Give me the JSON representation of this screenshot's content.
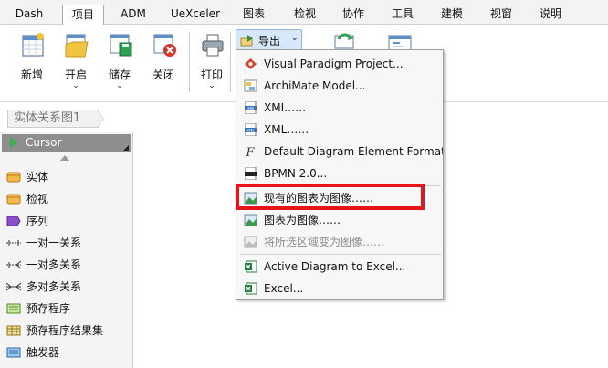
{
  "menubar": {
    "tabs": [
      "Dash",
      "项目",
      "ADM",
      "UeXceler",
      "图表",
      "检视",
      "协作",
      "工具",
      "建模",
      "视窗",
      "说明"
    ],
    "active_tab": "项目"
  },
  "ribbon": {
    "new_label": "新增",
    "open_label": "开启",
    "save_label": "储存",
    "close_label": "关闭",
    "print_label": "打印",
    "export_label": "导出"
  },
  "breadcrumb": {
    "item": "实体关系图1"
  },
  "palette": {
    "cursor_label": "Cursor",
    "items": [
      "实体",
      "检视",
      "序列",
      "一对一关系",
      "一对多关系",
      "多对多关系",
      "预存程序",
      "预存程序结果集",
      "触发器"
    ]
  },
  "export_menu": {
    "items": [
      "Visual Paradigm Project...",
      "ArchiMate Model...",
      "XMI……",
      "XML……",
      "Default Diagram Element Format...",
      "BPMN 2.0...",
      "现有的图表为图像……",
      "图表为图像……",
      "将所选区域变为图像……",
      "Active Diagram to Excel...",
      "Excel..."
    ],
    "disabled_item": "将所选区域变为图像……",
    "highlighted_item": "现有的图表为图像……"
  },
  "colors": {
    "highlight": "#e8141b",
    "accent": "#d7e8fa",
    "cursor_bg": "#8e8e8e"
  }
}
